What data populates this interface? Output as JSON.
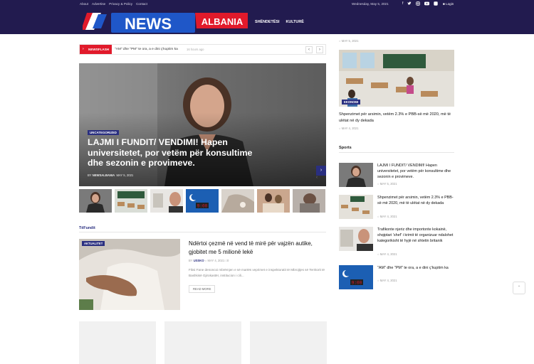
{
  "topbar": {
    "links": [
      "About",
      "Advertise",
      "Privacy & Policy",
      "Contact"
    ],
    "date": "Wednesday, May 5, 2021",
    "login": "Login"
  },
  "logo": {
    "word": "NEWS",
    "country": "ALBANIA"
  },
  "nav": {
    "items": [
      "SHËNDETËSI",
      "KULTURË"
    ]
  },
  "newsflash": {
    "label": "NEWSFLASH",
    "headline": "\"AM\" dhe \"PM\" te ora, a e dini ç'kuptim ka",
    "time": "16 hours ago"
  },
  "hero": {
    "category": "UNCATEGORIZED",
    "title": "LAJMI I FUNDIT/ VENDIMI! Hapen universitetet, por vetëm për konsultime dhe sezonin e provimeve.",
    "author": "NEWSALBANIA",
    "date": "MAY 5, 2021"
  },
  "section": {
    "title": "TëFundit"
  },
  "article": {
    "category": "AKTUALITET",
    "title": "Ndërtoi çezmë në vend të mirë për vajzën autike, gjobitet me 5 milionë lekë",
    "author": "USSKO",
    "date": "MAY 4, 2021",
    "comments": "0",
    "excerpt": "Fiksi Fane denoncoi mbrëmjen e së martës veprimet e inspektoratit të Mbrojtjes së Territorit të Bashkisë Gjirokastër, institucion i cili...",
    "read_more": "READ MORE"
  },
  "sidebar": {
    "top_date": "MAY 5, 2021",
    "feature": {
      "category": "EKONOMI",
      "title": "Shpenzimet për arsimin, vetëm 2.3% e PBB-së më 2020, më të ulëtat në dy dekada",
      "date": "MAY 4, 2021"
    },
    "sports_title": "Sports",
    "sports": [
      {
        "title": "LAJMI I FUNDIT/ VENDIMI! Hapen universitetet, por vetëm për konsultime dhe sezonin e provimeve.",
        "date": "MAY 5, 2021"
      },
      {
        "title": "Shpenzimet për arsimin, vetëm 2.3% e PBB-së më 2020, më të ulëtat në dy dekada",
        "date": "MAY 4, 2021"
      },
      {
        "title": "Trafikonte njeriz dhe importonte kokainë, shqiptari 'shef' i krimit të organizuar ndalohet kategorikisht të hyjë në shtetin britanik",
        "date": "MAY 4, 2021"
      },
      {
        "title": "\"AM\" dhe \"PM\" te ora, a e dini ç'kuptim ka",
        "date": "MAY 4, 2021"
      }
    ]
  },
  "colors": {
    "navy": "#221b4f",
    "accent_red": "#e11a2b",
    "badge_blue": "#2a2f80"
  }
}
